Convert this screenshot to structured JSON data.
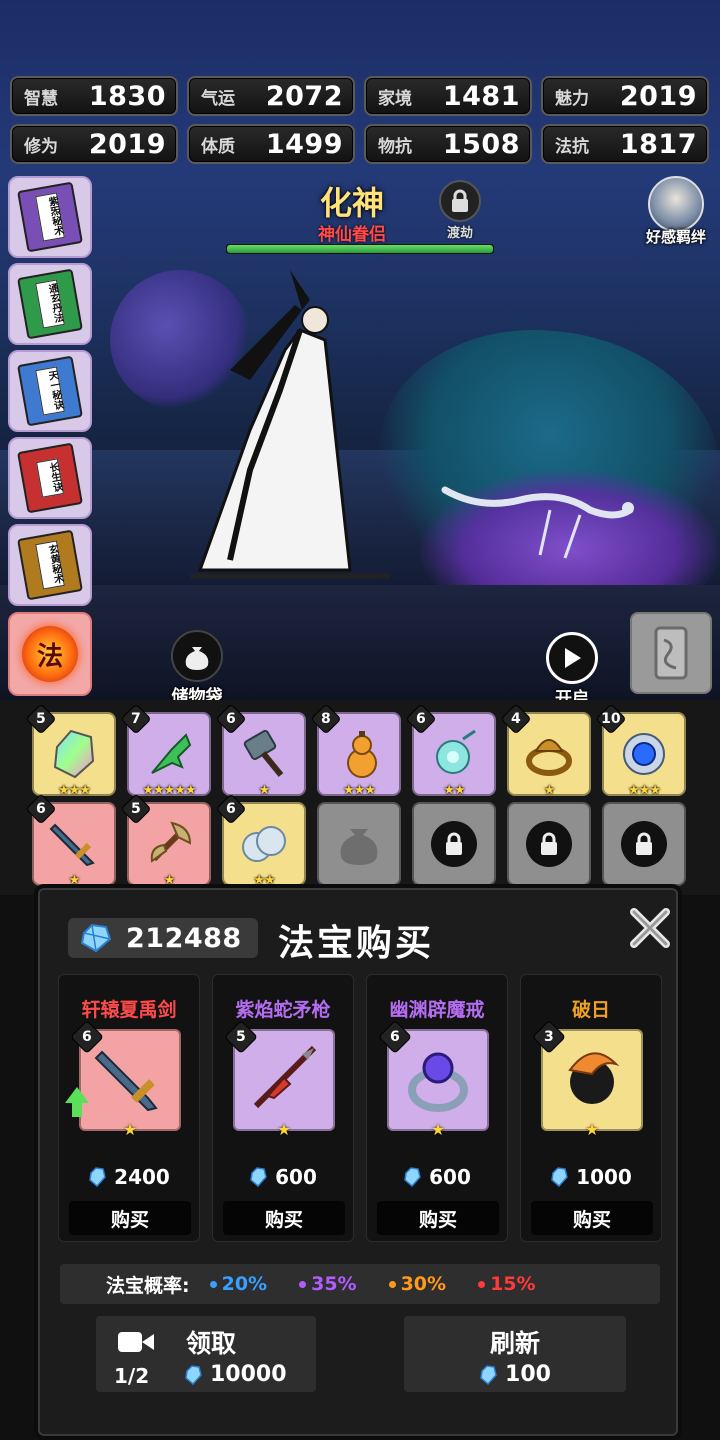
{
  "stats": [
    {
      "label": "智慧",
      "value": "1830"
    },
    {
      "label": "气运",
      "value": "2072"
    },
    {
      "label": "家境",
      "value": "1481"
    },
    {
      "label": "魅力",
      "value": "2019"
    },
    {
      "label": "修为",
      "value": "2019"
    },
    {
      "label": "体质",
      "value": "1499"
    },
    {
      "label": "物抗",
      "value": "1508"
    },
    {
      "label": "法抗",
      "value": "1817"
    }
  ],
  "realm": {
    "name": "化神",
    "subtitle": "神仙眷侣",
    "tribulation_label": "渡劫",
    "progress": 1.0
  },
  "affection": {
    "label": "好感羁绊"
  },
  "books": [
    {
      "title": "紫炁秘术",
      "color": "#7a4fb5"
    },
    {
      "title": "通玄丹法",
      "color": "#2f9a4a"
    },
    {
      "title": "天一秘诀",
      "color": "#3d7ad0"
    },
    {
      "title": "长生诀",
      "color": "#c73030"
    },
    {
      "title": "玄黄秘术",
      "color": "#b07a1e"
    }
  ],
  "skill_button": {
    "label": "法"
  },
  "bag": {
    "label": "储物袋"
  },
  "open": {
    "label": "开启"
  },
  "inventory": [
    {
      "level": "5",
      "stars": "★★★",
      "rarity": "gold",
      "icon": "crystal-icon"
    },
    {
      "level": "7",
      "stars": "★★★★★",
      "rarity": "purple",
      "icon": "jade-claw-icon"
    },
    {
      "level": "6",
      "stars": "★",
      "rarity": "purple",
      "icon": "hammer-icon"
    },
    {
      "level": "8",
      "stars": "★★★",
      "rarity": "purple",
      "icon": "gourd-icon"
    },
    {
      "level": "6",
      "stars": "★★",
      "rarity": "purple",
      "icon": "pendant-icon"
    },
    {
      "level": "4",
      "stars": "★",
      "rarity": "gold",
      "icon": "bronze-ring-icon"
    },
    {
      "level": "10",
      "stars": "★★★",
      "rarity": "gold",
      "icon": "orb-icon"
    },
    {
      "level": "6",
      "stars": "★",
      "rarity": "red",
      "icon": "sword-icon"
    },
    {
      "level": "5",
      "stars": "★",
      "rarity": "red",
      "icon": "axe-icon"
    },
    {
      "level": "6",
      "stars": "★★",
      "rarity": "gold",
      "icon": "cloud-icon"
    },
    {
      "level": "",
      "stars": "",
      "rarity": "gray",
      "icon": "bag-icon"
    },
    {
      "level": "",
      "stars": "",
      "rarity": "gray",
      "icon": "lock-icon"
    },
    {
      "level": "",
      "stars": "",
      "rarity": "gray",
      "icon": "lock-icon"
    },
    {
      "level": "",
      "stars": "",
      "rarity": "gray",
      "icon": "lock-icon"
    }
  ],
  "shop": {
    "gems": "212488",
    "title": "法宝购买",
    "items": [
      {
        "name": "轩辕夏禹剑",
        "name_color": "#ff4a4a",
        "level": "6",
        "stars": "★",
        "rarity": "red",
        "price": "2400",
        "buy": "购买",
        "upgrade": true
      },
      {
        "name": "紫焰蛇矛枪",
        "name_color": "#b46cf0",
        "level": "5",
        "stars": "★",
        "rarity": "purple",
        "price": "600",
        "buy": "购买",
        "upgrade": false
      },
      {
        "name": "幽渊辟魔戒",
        "name_color": "#b46cf0",
        "level": "6",
        "stars": "★",
        "rarity": "purple",
        "price": "600",
        "buy": "购买",
        "upgrade": false
      },
      {
        "name": "破日",
        "name_color": "#f0a020",
        "level": "3",
        "stars": "★",
        "rarity": "gold",
        "price": "1000",
        "buy": "购买",
        "upgrade": false
      }
    ],
    "rates_label": "法宝概率:",
    "rates": [
      {
        "value": "20%",
        "color": "#3aa0ff"
      },
      {
        "value": "35%",
        "color": "#b05cff"
      },
      {
        "value": "30%",
        "color": "#ff9a1a"
      },
      {
        "value": "15%",
        "color": "#ff3a3a"
      }
    ],
    "claim": {
      "label": "领取",
      "count": "1/2",
      "cost": "10000"
    },
    "refresh": {
      "label": "刷新",
      "cost": "100"
    }
  }
}
